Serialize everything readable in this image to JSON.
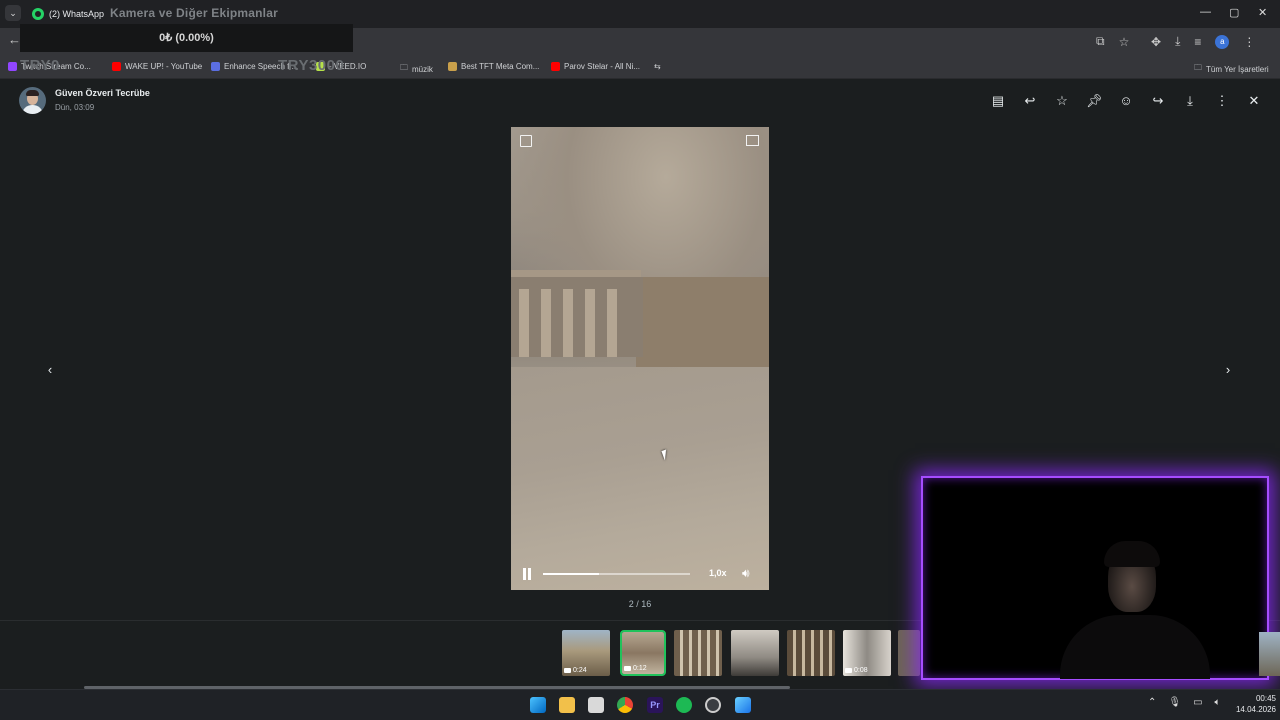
{
  "browser": {
    "active_tab_title": "(2) WhatsApp",
    "overlay_title": "Kamera ve Diğer Ekipmanlar",
    "stat_overlay": "0₺ (0.00%)",
    "bookmarks": [
      {
        "label": "Twitch Stream Co..."
      },
      {
        "label": "WAKE UP! - YouTube"
      },
      {
        "label": "Enhance Speech fr..."
      },
      {
        "label": "- VEED.IO"
      },
      {
        "label": "müzik"
      },
      {
        "label": "Best TFT Meta Com..."
      },
      {
        "label": "Parov Stelar - All Ni..."
      },
      {
        "label": "Tüm Yer İşaretleri"
      }
    ],
    "overlay_left": "TRY0",
    "overlay_mid": "TRY3000",
    "profile_letter": "a"
  },
  "viewer": {
    "sender_name": "Güven Özveri Tecrübe",
    "sender_time": "Dün, 03:09",
    "speed": "1,0x",
    "counter": "2 / 16",
    "progress": 0.38,
    "thumbnails": [
      {
        "duration": "0:24",
        "selected": false
      },
      {
        "duration": "0:12",
        "selected": true
      },
      {
        "duration": "",
        "selected": false
      },
      {
        "duration": "",
        "selected": false
      },
      {
        "duration": "",
        "selected": false
      },
      {
        "duration": "0:08",
        "selected": false
      }
    ]
  },
  "taskbar": {
    "time": "00:45",
    "date": "14.04.2026"
  }
}
